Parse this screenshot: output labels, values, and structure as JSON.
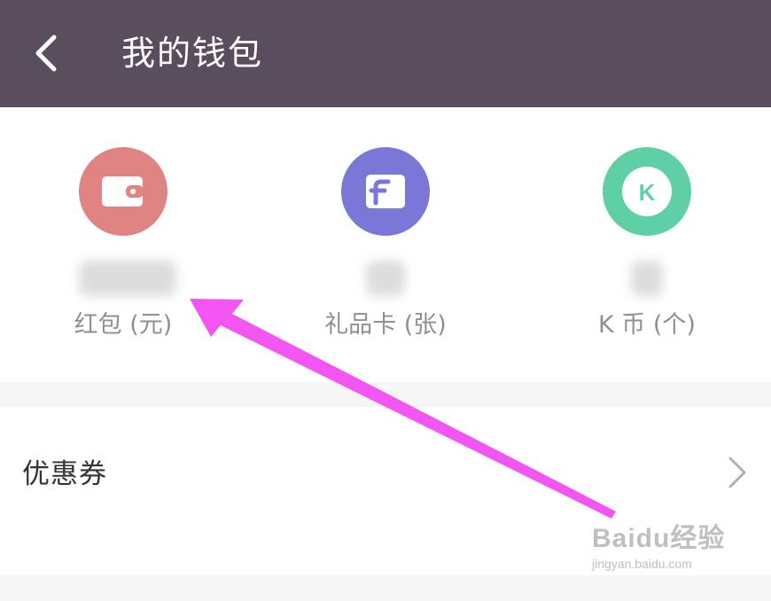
{
  "header": {
    "title": "我的钱包",
    "bg": "#5a4d5e"
  },
  "wallet": [
    {
      "label": "红包 (元)",
      "color": "#e08383",
      "icon": "wallet-icon"
    },
    {
      "label": "礼品卡 (张)",
      "color": "#7a77d8",
      "icon": "gift-card-icon"
    },
    {
      "label": "K 币 (个)",
      "color": "#5fd0a6",
      "icon": "k-coin-icon",
      "icon_text": "K"
    }
  ],
  "coupon": {
    "label": "优惠券"
  },
  "watermark": {
    "main": "Baidu经验",
    "sub": "jingyan.baidu.com"
  },
  "annotation": {
    "color": "#f255f2",
    "icon": "arrow"
  }
}
